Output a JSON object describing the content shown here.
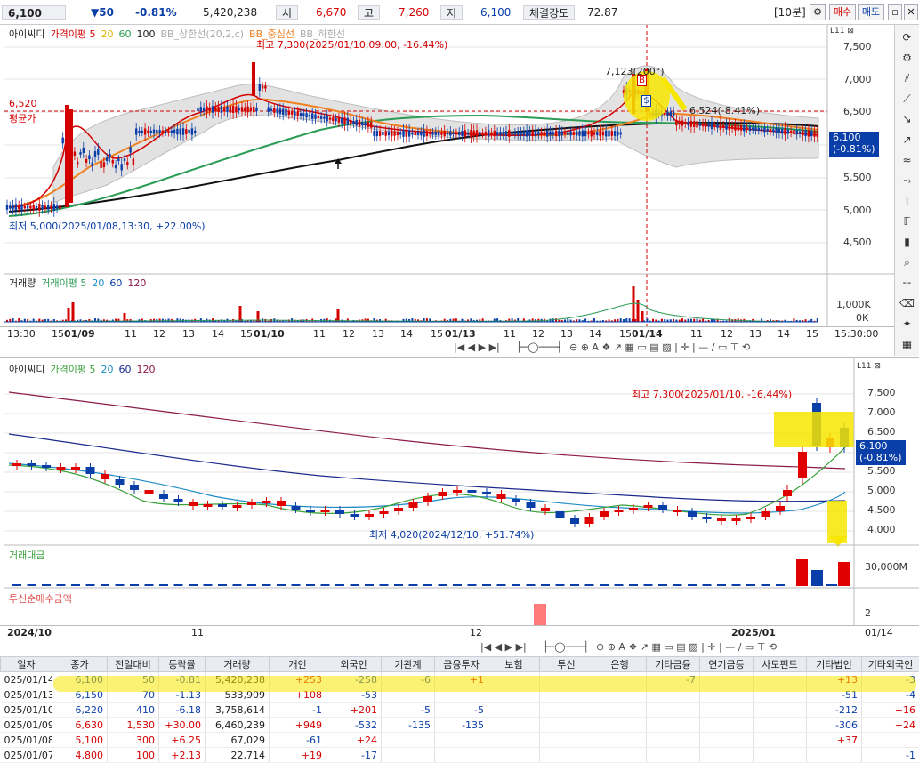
{
  "topbar": {
    "price": "6,100",
    "change": "▼50",
    "change_pct": "-0.81%",
    "volume": "5,420,238",
    "open_label": "시",
    "open": "6,670",
    "high_label": "고",
    "high": "7,260",
    "low_label": "저",
    "low": "6,100",
    "strength_label": "체결강도",
    "strength": "72.87",
    "period": "[10분]",
    "buy": "매수",
    "sell": "매도"
  },
  "chart1": {
    "legend": {
      "name": "아이씨디",
      "ma": "가격이평 5",
      "ma20": "20",
      "ma60": "60",
      "ma100": "100",
      "bb_upper": "BB_상한선(20,2,c)",
      "bb_mid": "BB_중심선",
      "bb_low": "BB_하한선"
    },
    "annot_high": "최고 7,300(2025/01/10,09:00, -16.44%)",
    "annot_low": "최저 5,000(2025/01/08,13:30, +22.00%)",
    "annot_avg_price": "6,520",
    "annot_avg_label": "평균가",
    "annot_peak": "7,123(200°)",
    "annot_right": "6,524(-8.41%)",
    "badge_b": "B",
    "badge_s": "$",
    "current_price": "6,100",
    "current_pct": "(-0.81%)",
    "yticks": [
      "7,500",
      "7,000",
      "6,500",
      "6,000",
      "5,500",
      "5,000",
      "4,500"
    ],
    "vol_legend": {
      "name": "거래량",
      "ma": "거래이평 5",
      "v20": "20",
      "v60": "60",
      "v120": "120"
    },
    "vol_ticks": [
      "1,000K",
      "0K"
    ],
    "xticks": [
      "13:30",
      "15",
      "01/09",
      "11",
      "12",
      "13",
      "14",
      "15",
      "01/10",
      "11",
      "12",
      "13",
      "14",
      "15",
      "01/13",
      "11",
      "12",
      "13",
      "14",
      "15",
      "01/14",
      "11",
      "12",
      "13",
      "14",
      "15",
      "15:30:00"
    ]
  },
  "chart2": {
    "legend": {
      "name": "아이씨디",
      "ma": "가격이평 5",
      "ma20": "20",
      "ma60": "60",
      "ma120": "120"
    },
    "annot_high": "최고 7,300(2025/01/10, -16.44%)",
    "annot_low": "최저 4,020(2024/12/10, +51.74%)",
    "current_price": "6,100",
    "current_pct": "(-0.81%)",
    "yticks": [
      "7,500",
      "7,000",
      "6,500",
      "6,000",
      "5,500",
      "5,000",
      "4,500",
      "4,000"
    ],
    "amount_legend": "거래대금",
    "amount_tick": "30,000M",
    "inst_legend": "투신순매수금액",
    "inst_tick": "2",
    "xticks": [
      "2024/10",
      "11",
      "12",
      "2025/01",
      "01/14"
    ]
  },
  "grid": {
    "headers": [
      "일자",
      "종가",
      "전일대비",
      "등락률",
      "거래량",
      "개인",
      "외국인",
      "기관계",
      "금융투자",
      "보험",
      "투신",
      "은행",
      "기타금융",
      "연기금등",
      "사모펀드",
      "기타법인",
      "기타외국인"
    ],
    "rows": [
      [
        "025/01/14",
        "6,100",
        "50",
        "-0.81",
        "5,420,238",
        "+253",
        "-258",
        "-6",
        "+1",
        "",
        "",
        "",
        "-7",
        "",
        "",
        "+13",
        "-3"
      ],
      [
        "025/01/13",
        "6,150",
        "70",
        "-1.13",
        "533,909",
        "+108",
        "-53",
        "",
        "",
        "",
        "",
        "",
        "",
        "",
        "",
        "-51",
        "-4"
      ],
      [
        "025/01/10",
        "6,220",
        "410",
        "-6.18",
        "3,758,614",
        "-1",
        "+201",
        "-5",
        "-5",
        "",
        "",
        "",
        "",
        "",
        "",
        "-212",
        "+16"
      ],
      [
        "025/01/09",
        "6,630",
        "1,530",
        "+30.00",
        "6,460,239",
        "+949",
        "-532",
        "-135",
        "-135",
        "",
        "",
        "",
        "",
        "",
        "",
        "-306",
        "+24"
      ],
      [
        "025/01/08",
        "5,100",
        "300",
        "+6.25",
        "67,029",
        "-61",
        "+24",
        "",
        "",
        "",
        "",
        "",
        "",
        "",
        "",
        "+37",
        ""
      ],
      [
        "025/01/07",
        "4,800",
        "100",
        "+2.13",
        "22,714",
        "+19",
        "-17",
        "",
        "",
        "",
        "",
        "",
        "",
        "",
        "",
        "",
        "-1"
      ]
    ]
  },
  "colors": {
    "up": "#d40000",
    "down": "#0a3ea8",
    "highlight": "#f7e600"
  }
}
